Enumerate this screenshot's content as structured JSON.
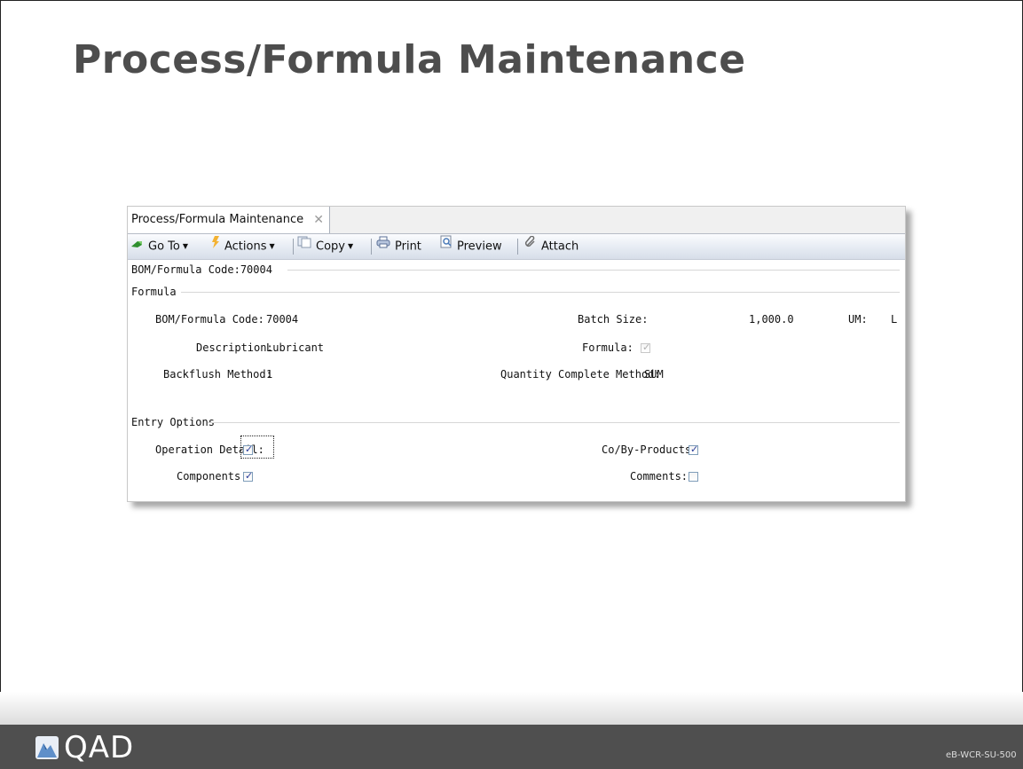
{
  "slide": {
    "title": "Process/Formula Maintenance",
    "brand": "QAD",
    "doc_code": "eB-WCR-SU-500"
  },
  "window": {
    "tab_label": "Process/Formula Maintenance",
    "tab_close": "✕",
    "toolbar": {
      "goto_label": "Go To",
      "actions_label": "Actions",
      "copy_label": "Copy",
      "print_label": "Print",
      "preview_label": "Preview",
      "attach_label": "Attach"
    },
    "header_code": "BOM/Formula Code:70004",
    "sections": {
      "formula": "Formula",
      "entry_options": "Entry Options"
    },
    "fields": {
      "bom_code_label": "BOM/Formula Code:",
      "bom_code_value": "70004",
      "description_label": "Description:",
      "description_value": "Lubricant",
      "backflush_label": "Backflush Method:",
      "backflush_value": "1",
      "batch_size_label": "Batch Size:",
      "batch_size_value": "1,000.0",
      "um_label": "UM:",
      "um_value": "L",
      "formula_label": "Formula:",
      "formula_checked": true,
      "qty_complete_label": "Quantity Complete Method:",
      "qty_complete_value": "SUM"
    },
    "options": {
      "operation_detail_label": "Operation Detail:",
      "operation_detail_checked": true,
      "components_label": "Components:",
      "components_checked": true,
      "coby_label": "Co/By-Products:",
      "coby_checked": true,
      "comments_label": "Comments:",
      "comments_checked": false
    }
  },
  "colors": {
    "title": "#4d4d4d",
    "footer": "#4f4f4f",
    "checkbox_tick": "#2a3d9b",
    "toolbar_gradient_end": "#d7dee9"
  },
  "icons": [
    "goto-icon",
    "actions-icon",
    "copy-icon",
    "print-icon",
    "preview-icon",
    "attach-icon",
    "qad-logo-icon",
    "tab-close-icon"
  ]
}
